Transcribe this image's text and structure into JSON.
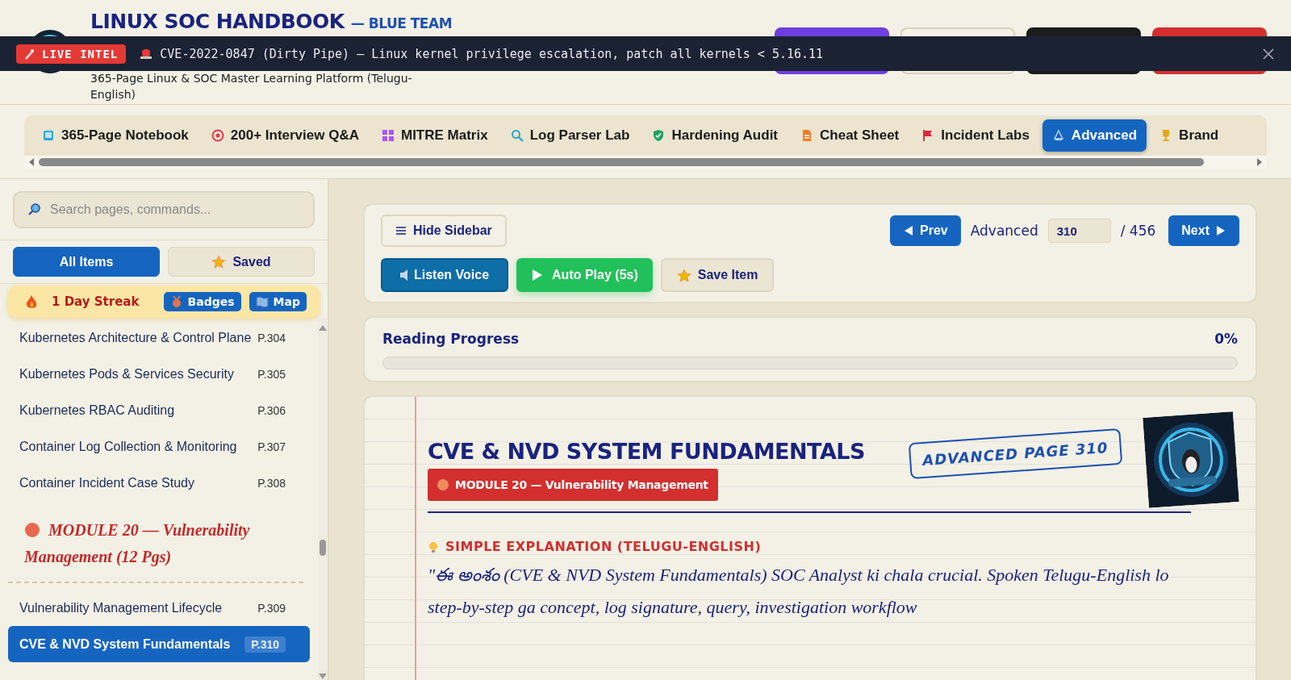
{
  "header": {
    "title": "LINUX SOC HANDBOOK",
    "title_suffix": "— BLUE TEAM",
    "subtitle": "365-Page Linux & SOC Master Learning Platform (Telugu-English)",
    "buttons": [
      {
        "color": "#6d3fe0"
      },
      {
        "color": "#f4f1e6"
      },
      {
        "color": "#1c1c1c"
      },
      {
        "color": "#d32f2f"
      }
    ]
  },
  "banner": {
    "label": "LIVE INTEL",
    "message": "CVE-2022-0847 (Dirty Pipe) — Linux kernel privilege escalation, patch all kernels < 5.16.11"
  },
  "nav_tabs": [
    {
      "label": "365-Page Notebook",
      "selected": false
    },
    {
      "label": "200+ Interview Q&A",
      "selected": false
    },
    {
      "label": "MITRE Matrix",
      "selected": false
    },
    {
      "label": "Log Parser Lab",
      "selected": false
    },
    {
      "label": "Hardening Audit",
      "selected": false
    },
    {
      "label": "Cheat Sheet",
      "selected": false
    },
    {
      "label": "Incident Labs",
      "selected": false
    },
    {
      "label": "Advanced",
      "selected": true
    },
    {
      "label": "Brand",
      "selected": false
    }
  ],
  "sidebar": {
    "search": {
      "placeholder": "Search pages, commands..."
    },
    "filters": [
      {
        "label": "All Items",
        "selected": true
      },
      {
        "label": "Saved",
        "selected": false
      }
    ],
    "streak": "1 Day Streak",
    "streak_buttons": [
      "Badges",
      "Map"
    ],
    "items": [
      {
        "kind": "page",
        "title": "Kubernetes Architecture & Control Plane",
        "page": "P.304",
        "selected": false
      },
      {
        "kind": "page",
        "title": "Kubernetes Pods & Services Security",
        "page": "P.305",
        "selected": false
      },
      {
        "kind": "page",
        "title": "Kubernetes RBAC Auditing",
        "page": "P.306",
        "selected": false
      },
      {
        "kind": "page",
        "title": "Container Log Collection & Monitoring",
        "page": "P.307",
        "selected": false
      },
      {
        "kind": "page",
        "title": "Container Incident Case Study",
        "page": "P.308",
        "selected": false
      },
      {
        "kind": "module",
        "title": "MODULE 20 — Vulnerability Management (12 Pgs)"
      },
      {
        "kind": "page",
        "title": "Vulnerability Management Lifecycle",
        "page": "P.309",
        "selected": false
      },
      {
        "kind": "page",
        "title": "CVE & NVD System Fundamentals",
        "page": "P.310",
        "selected": true
      }
    ]
  },
  "toolbar": {
    "hide_sidebar": "Hide Sidebar",
    "prev": "Prev",
    "section": "Advanced",
    "page_value": "310",
    "total": "/ 456",
    "next": "Next",
    "actions": [
      "Listen Voice",
      "Auto Play (5s)",
      "Save Item"
    ]
  },
  "progress": {
    "label": "Reading Progress",
    "reading": "0%",
    "level": 0
  },
  "page": {
    "title": "CVE & NVD SYSTEM FUNDAMENTALS",
    "stamp": "ADVANCED PAGE 310",
    "module": "MODULE 20 — Vulnerability Management",
    "section_heading": "SIMPLE EXPLANATION (TELUGU-ENGLISH)",
    "body": "\"ఈ అంశం (CVE & NVD System Fundamentals) SOC Analyst ki chala crucial. Spoken Telugu-English lo step-by-step ga concept, log signature, query, investigation workflow"
  }
}
